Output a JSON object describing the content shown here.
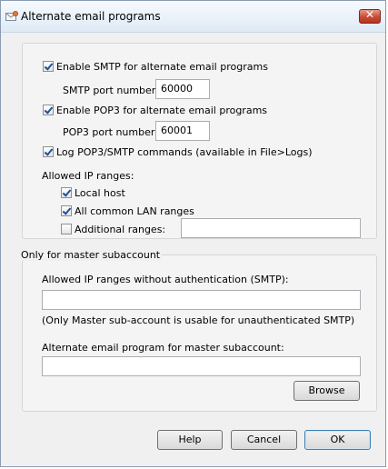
{
  "window": {
    "title": "Alternate email programs",
    "close_glyph": "✕",
    "icon": "envelope-gear-icon"
  },
  "smtp": {
    "enable_label": "Enable SMTP for alternate email programs",
    "enabled": true,
    "port_label": "SMTP port number:",
    "port_value": "60000"
  },
  "pop3": {
    "enable_label": "Enable POP3 for alternate email programs",
    "enabled": true,
    "port_label": "POP3 port number:",
    "port_value": "60001"
  },
  "log": {
    "label": "Log POP3/SMTP commands (available in File>Logs)",
    "enabled": true
  },
  "allowed_ip": {
    "heading": "Allowed IP ranges:",
    "local_host_label": "Local host",
    "local_host_checked": true,
    "lan_label": "All common LAN ranges",
    "lan_checked": true,
    "additional_label": "Additional ranges:",
    "additional_checked": false,
    "additional_value": ""
  },
  "master": {
    "section_title": "Only for master subaccount",
    "no_auth_label": "Allowed IP ranges without authentication (SMTP):",
    "no_auth_value": "",
    "note": "(Only Master sub-account is usable for unauthenticated SMTP)",
    "program_label": "Alternate email program for master subaccount:",
    "program_value": "",
    "browse_label": "Browse"
  },
  "buttons": {
    "help": "Help",
    "cancel": "Cancel",
    "ok": "OK"
  }
}
